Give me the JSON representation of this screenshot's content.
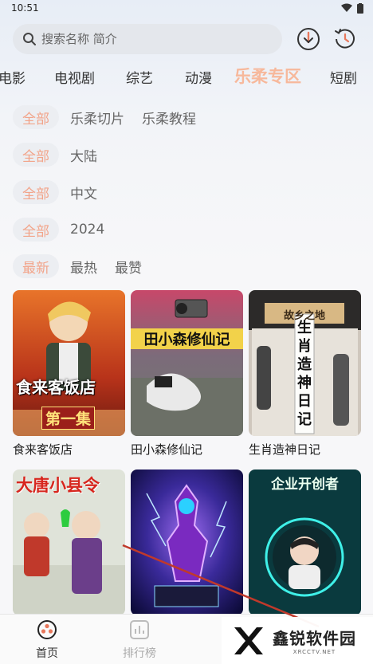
{
  "status": {
    "time": "10:51"
  },
  "search": {
    "placeholder": "搜索名称 简介"
  },
  "top_icons": [
    "download-icon",
    "history-icon"
  ],
  "categories": [
    "电影",
    "电视剧",
    "综艺",
    "动漫",
    "乐柔专区",
    "短剧"
  ],
  "active_category": "乐柔专区",
  "filters": [
    {
      "chip": "全部",
      "options": [
        "乐柔切片",
        "乐柔教程"
      ]
    },
    {
      "chip": "全部",
      "options": [
        "大陆"
      ]
    },
    {
      "chip": "全部",
      "options": [
        "中文"
      ]
    },
    {
      "chip": "全部",
      "options": [
        "2024"
      ]
    },
    {
      "chip": "最新",
      "options": [
        "最热",
        "最赞"
      ]
    }
  ],
  "items": [
    {
      "title": "食来客饭店",
      "poster_text": "食来客饭店",
      "poster_sub": "第一集"
    },
    {
      "title": "田小森修仙记",
      "poster_text": "田小森修仙记"
    },
    {
      "title": "生肖造神日记",
      "poster_text": "生肖造神日记",
      "poster_sign": "故乡之地"
    },
    {
      "title": "",
      "poster_text": "大唐小县令"
    },
    {
      "title": "",
      "poster_text": ""
    },
    {
      "title": "",
      "poster_text": "企业开创者"
    }
  ],
  "tabbar": [
    {
      "label": "首页",
      "icon": "home-icon",
      "active": true
    },
    {
      "label": "排行榜",
      "icon": "chart-icon",
      "active": false
    }
  ],
  "watermark": {
    "text": "鑫锐软件园",
    "sub": "XRCCTV.NET"
  },
  "colors": {
    "accent": "#f7b89b",
    "chip_text": "#f2a48a"
  }
}
